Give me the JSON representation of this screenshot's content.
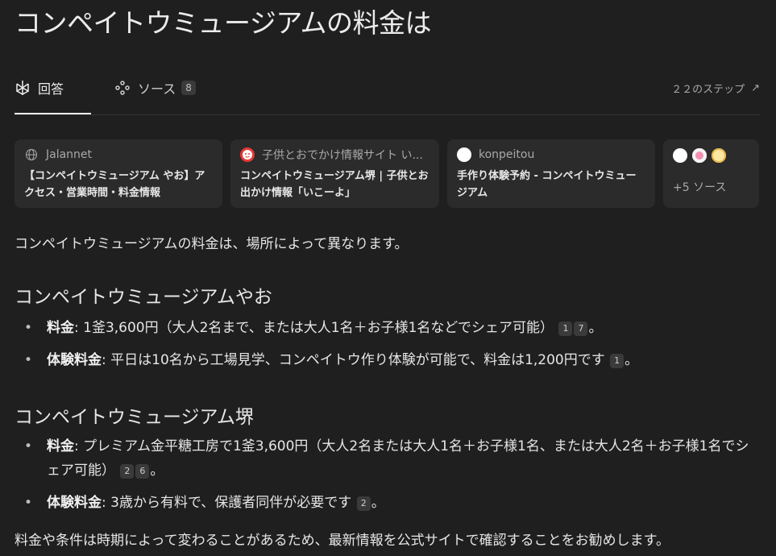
{
  "title": "コンペイトウミュージアムの料金は",
  "tabs": {
    "answer_label": "回答",
    "sources_label": "ソース",
    "sources_count": "8",
    "steps_label": "２２のステップ"
  },
  "source_cards": [
    {
      "site": "Jalannet",
      "title": "【コンペイトウミュージアム やお】アクセス・営業時間・料金情報"
    },
    {
      "site": "子供とおでかけ情報サイト い...",
      "title": "コンペイトウミュージアム堺 | 子供とお出かけ情報「いこーよ」"
    },
    {
      "site": "konpeitou",
      "title": "手作り体験予約 - コンペイトウミュージアム"
    }
  ],
  "more_sources": {
    "label": "+5 ソース"
  },
  "answer": {
    "intro": "コンペイトウミュージアムの料金は、場所によって異なります。",
    "sections": [
      {
        "heading": "コンペイトウミュージアムやお",
        "items": [
          {
            "label": "料金",
            "text": ": 1釜3,600円（大人2名まで、または大人1名＋お子様1名などでシェア可能）",
            "cites": [
              "1",
              "7"
            ],
            "end": "。"
          },
          {
            "label": "体験料金",
            "text": ": 平日は10名から工場見学、コンペイトウ作り体験が可能で、料金は1,200円です",
            "cites": [
              "1"
            ],
            "end": "。"
          }
        ]
      },
      {
        "heading": "コンペイトウミュージアム堺",
        "items": [
          {
            "label": "料金",
            "text": ": プレミアム金平糖工房で1釜3,600円（大人2名または大人1名＋お子様1名、または大人2名＋お子様1名でシェア可能）",
            "cites": [
              "2",
              "6"
            ],
            "end": "。"
          },
          {
            "label": "体験料金",
            "text": ": 3歳から有料で、保護者同伴が必要です",
            "cites": [
              "2"
            ],
            "end": "。"
          }
        ]
      }
    ],
    "outro": "料金や条件は時期によって変わることがあるため、最新情報を公式サイトで確認することをお勧めします。"
  },
  "icons": {
    "answer_tab": "perplexity-answer-icon",
    "sources_tab": "sources-dots-icon",
    "steps": "arrow-up-right-icon",
    "card_1": "globe-icon",
    "card_2": "ikoyo-logo-icon",
    "card_3": "konpeitou-favicon"
  },
  "colors": {
    "background": "#1f1f1f",
    "card": "#2b2b2b",
    "badge": "#3a3a3a",
    "text": "#e6e6e6",
    "muted": "#a9a9a9",
    "ikoyo_red": "#e53935"
  }
}
